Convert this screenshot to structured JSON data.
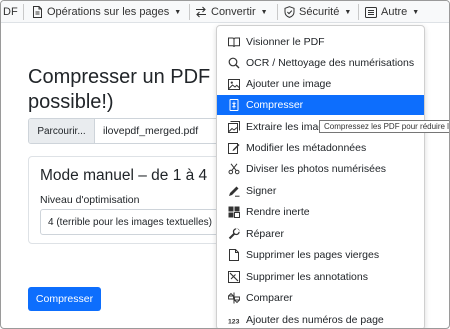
{
  "navbar": {
    "partial_label": "DF",
    "items": [
      {
        "label": "Opérations sur les pages",
        "icon": "file-icon"
      },
      {
        "label": "Convertir",
        "icon": "arrows-icon"
      },
      {
        "label": "Sécurité",
        "icon": "shield-icon"
      },
      {
        "label": "Autre",
        "icon": "list-icon"
      }
    ]
  },
  "main": {
    "title": "Compresser un PDF possible!)",
    "browse_label": "Parcourir...",
    "file_name": "ilovepdf_merged.pdf",
    "card_title": "Mode manuel – de 1 à 4",
    "level_label": "Niveau d'optimisation",
    "level_value": "4 (terrible pour les images textuelles)",
    "submit_label": "Compresser"
  },
  "dropdown": {
    "items": [
      {
        "label": "Visionner le PDF",
        "icon": "book-icon"
      },
      {
        "label": "OCR / Nettoyage des numérisations",
        "icon": "search-icon"
      },
      {
        "label": "Ajouter une image",
        "icon": "image-icon"
      },
      {
        "label": "Compresser",
        "icon": "compress-icon"
      },
      {
        "label": "Extraire les images",
        "icon": "images-icon"
      },
      {
        "label": "Modifier les métadonnées",
        "icon": "edit-icon"
      },
      {
        "label": "Diviser les photos numérisées",
        "icon": "scissors-icon"
      },
      {
        "label": "Signer",
        "icon": "signature-icon"
      },
      {
        "label": "Rendre inerte",
        "icon": "layers-icon"
      },
      {
        "label": "Réparer",
        "icon": "wrench-icon"
      },
      {
        "label": "Supprimer les pages vierges",
        "icon": "blank-page-icon"
      },
      {
        "label": "Supprimer les annotations",
        "icon": "no-annotation-icon"
      },
      {
        "label": "Comparer",
        "icon": "compare-icon"
      },
      {
        "label": "Ajouter des numéros de page",
        "icon": "numbers-icon"
      }
    ],
    "active_index": 3
  },
  "tooltip": {
    "text": "Compressez les PDF pour réduire le"
  },
  "colors": {
    "accent": "#0d6efd",
    "navbar_bg": "#f8f9fa"
  }
}
